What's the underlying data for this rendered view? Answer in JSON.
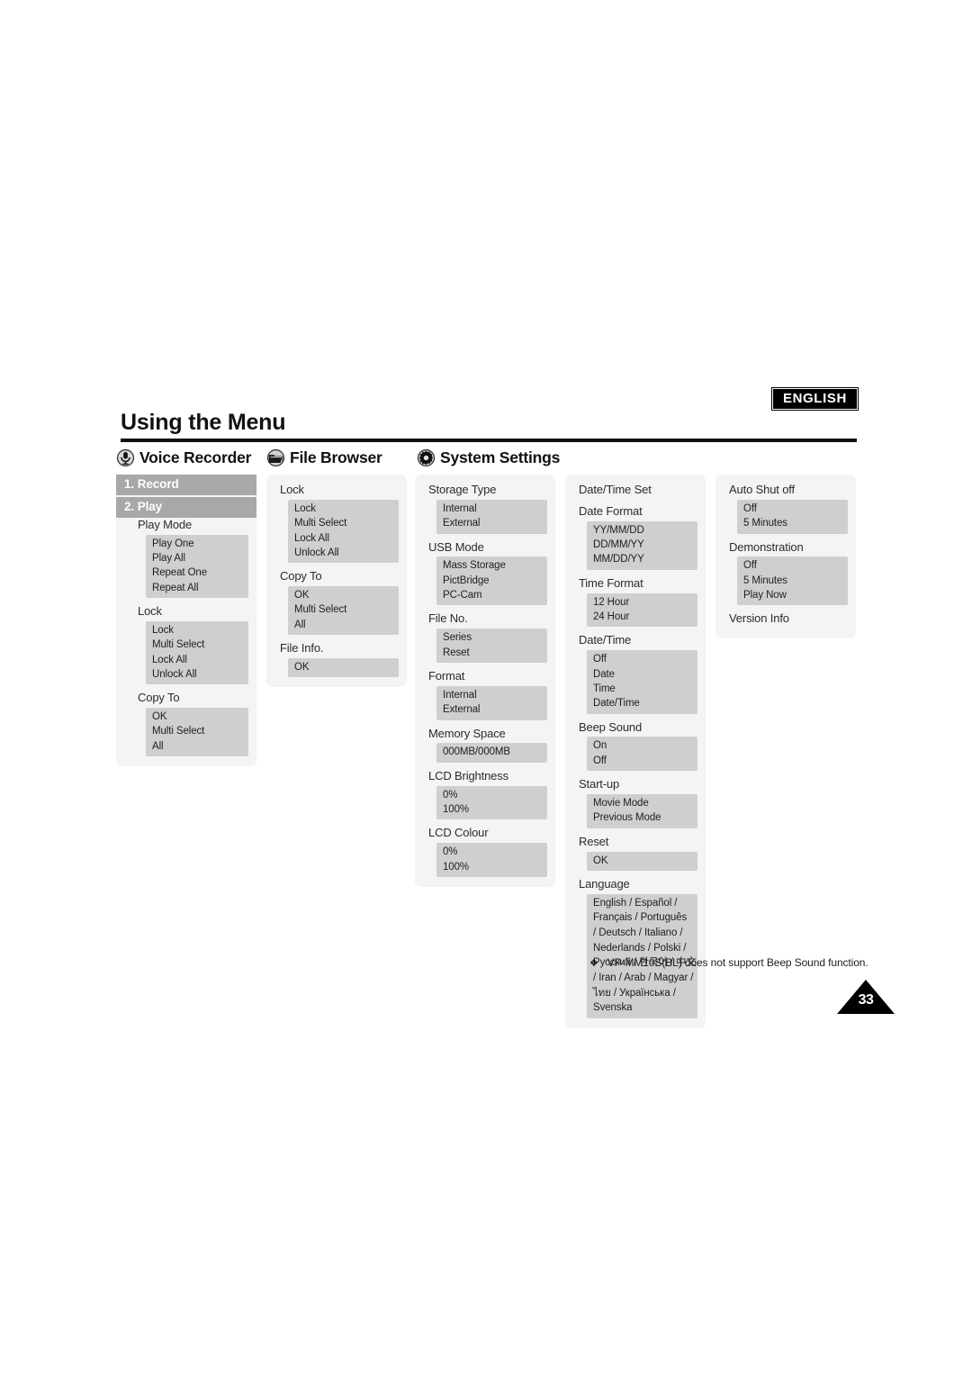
{
  "language_badge": "ENGLISH",
  "page_title": "Using the Menu",
  "page_number": "33",
  "footnote": {
    "bullet": "❖",
    "text": "VP-MM10S(BL) does not support Beep Sound function."
  },
  "sections": [
    {
      "icon": "microphone-icon",
      "label": "Voice Recorder"
    },
    {
      "icon": "folder-icon",
      "label": "File Browser"
    },
    {
      "icon": "gear-icon",
      "label": "System Settings"
    }
  ],
  "voice_recorder": {
    "numbered": [
      {
        "label": "1. Record"
      },
      {
        "label": "2. Play"
      }
    ],
    "groups": [
      {
        "label": "Play Mode",
        "options": [
          "Play One",
          "Play All",
          "Repeat One",
          "Repeat All"
        ]
      },
      {
        "label": "Lock",
        "options": [
          "Lock",
          "Multi Select",
          "Lock All",
          "Unlock All"
        ]
      },
      {
        "label": "Copy To",
        "options": [
          "OK",
          "Multi Select",
          "All"
        ]
      }
    ]
  },
  "file_browser": {
    "groups": [
      {
        "label": "Lock",
        "options": [
          "Lock",
          "Multi Select",
          "Lock All",
          "Unlock All"
        ]
      },
      {
        "label": "Copy To",
        "options": [
          "OK",
          "Multi Select",
          "All"
        ]
      },
      {
        "label": "File Info.",
        "options": [
          "OK"
        ]
      }
    ]
  },
  "system_settings_col1": {
    "groups": [
      {
        "label": "Storage Type",
        "options": [
          "Internal",
          "External"
        ]
      },
      {
        "label": "USB Mode",
        "options": [
          "Mass Storage",
          "PictBridge",
          "PC-Cam"
        ]
      },
      {
        "label": "File No.",
        "options": [
          "Series",
          "Reset"
        ]
      },
      {
        "label": "Format",
        "options": [
          "Internal",
          "External"
        ]
      },
      {
        "label": "Memory Space",
        "options": [
          "000MB/000MB"
        ]
      },
      {
        "label": "LCD Brightness",
        "options": [
          "0%",
          "100%"
        ]
      },
      {
        "label": "LCD Colour",
        "options": [
          "0%",
          "100%"
        ]
      }
    ]
  },
  "system_settings_col2": {
    "groups": [
      {
        "label": "Date/Time Set",
        "options": []
      },
      {
        "label": "Date Format",
        "options": [
          "YY/MM/DD",
          "DD/MM/YY",
          "MM/DD/YY"
        ]
      },
      {
        "label": "Time Format",
        "options": [
          "12 Hour",
          "24 Hour"
        ]
      },
      {
        "label": "Date/Time",
        "options": [
          "Off",
          "Date",
          "Time",
          "Date/Time"
        ]
      },
      {
        "label": "Beep Sound",
        "options": [
          "On",
          "Off"
        ]
      },
      {
        "label": "Start-up",
        "options": [
          "Movie Mode",
          "Previous Mode"
        ]
      },
      {
        "label": "Reset",
        "options": [
          "OK"
        ]
      },
      {
        "label": "Language",
        "options": [
          "English / Español /",
          "Français / Português",
          "/ Deutsch / Italiano /",
          "Nederlands / Polski /",
          "Русский / 한국어 / 中文",
          "/ Iran / Arab / Magyar /",
          "ไทย / Українська /",
          "Svenska"
        ]
      }
    ]
  },
  "system_settings_col3": {
    "groups": [
      {
        "label": "Auto Shut off",
        "options": [
          "Off",
          "5 Minutes"
        ]
      },
      {
        "label": "Demonstration",
        "options": [
          "Off",
          "5 Minutes",
          "Play Now"
        ]
      },
      {
        "label": "Version Info",
        "options": []
      }
    ]
  }
}
